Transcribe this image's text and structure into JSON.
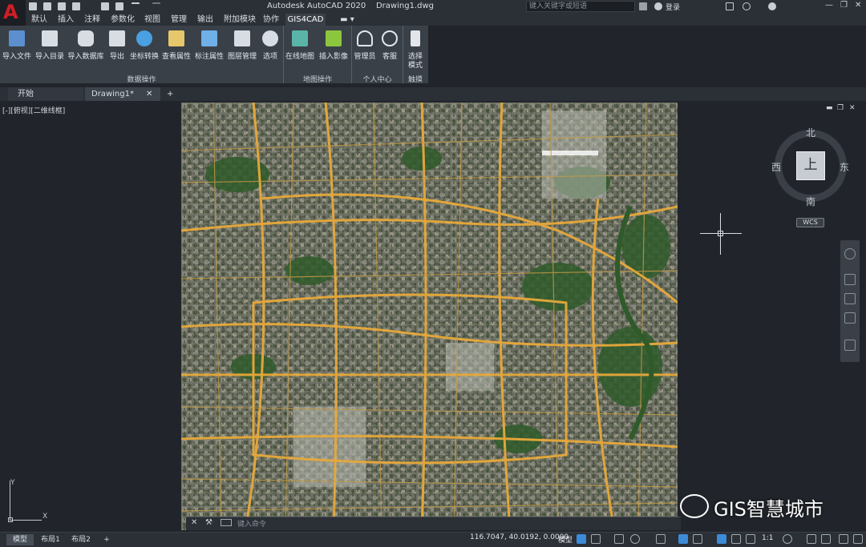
{
  "app": {
    "title": "Autodesk AutoCAD 2020    Drawing1.dwg",
    "logo_letter": "A"
  },
  "search": {
    "placeholder": "键入关键字或短语"
  },
  "account": {
    "login_label": "登录"
  },
  "menu_tabs": [
    {
      "label": "默认"
    },
    {
      "label": "插入"
    },
    {
      "label": "注释"
    },
    {
      "label": "参数化"
    },
    {
      "label": "视图"
    },
    {
      "label": "管理"
    },
    {
      "label": "输出"
    },
    {
      "label": "附加模块"
    },
    {
      "label": "协作"
    },
    {
      "label": "GIS4CAD",
      "active": true
    }
  ],
  "ribbon": {
    "buttons": [
      {
        "label": "导入文件",
        "icon": "folder-file-icon"
      },
      {
        "label": "导入目录",
        "icon": "folder-open-icon"
      },
      {
        "label": "导入数据库",
        "icon": "database-icon"
      },
      {
        "label": "导出",
        "icon": "export-icon"
      },
      {
        "label": "坐标转换",
        "icon": "coordinate-transform-icon"
      },
      {
        "label": "查看属性",
        "icon": "attribute-view-icon"
      },
      {
        "label": "标注属性",
        "icon": "attribute-label-icon"
      },
      {
        "label": "图层管理",
        "icon": "layers-icon"
      },
      {
        "label": "选项",
        "icon": "gear-icon"
      },
      {
        "label": "在线地图",
        "icon": "online-map-icon"
      },
      {
        "label": "插入影像",
        "icon": "insert-image-icon"
      },
      {
        "label": "管理员",
        "icon": "user-icon"
      },
      {
        "label": "客服",
        "icon": "info-icon"
      },
      {
        "label": "选择\n模式",
        "icon": "hand-pointer-icon"
      }
    ],
    "panels": [
      {
        "label": "数据操作"
      },
      {
        "label": "地图操作"
      },
      {
        "label": "个人中心"
      },
      {
        "label": "触摸"
      }
    ]
  },
  "doc_tabs": [
    {
      "label": "开始"
    },
    {
      "label": "Drawing1*",
      "active": true
    }
  ],
  "viewport": {
    "view_label": "[-][俯视][二维线框]",
    "viewcube": {
      "face": "上",
      "north": "北",
      "south": "南",
      "east": "东",
      "west": "西",
      "wcs": "WCS"
    },
    "ucs_x": "X",
    "ucs_y": "Y"
  },
  "command_line": {
    "placeholder": "键入命令"
  },
  "watermark": {
    "text": "GIS智慧城市"
  },
  "status": {
    "layout_tabs": [
      {
        "label": "模型",
        "active": true
      },
      {
        "label": "布局1"
      },
      {
        "label": "布局2"
      }
    ],
    "coords": "116.7047, 40.0192, 0.0000",
    "model_label": "模型",
    "scale": "1:1"
  },
  "colors": {
    "accent_red": "#d21d25",
    "road_yellow": "#e8a93a",
    "chrome_dark": "#2b2f36"
  }
}
